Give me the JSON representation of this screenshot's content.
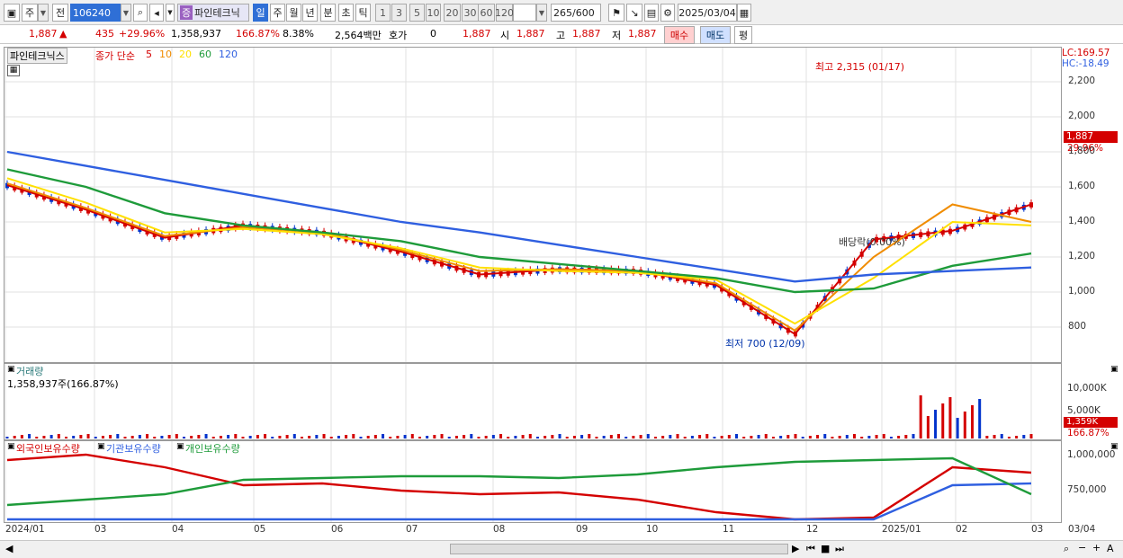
{
  "toolbar": {
    "market": "주",
    "ref": "전",
    "code": "106240",
    "stock_name": "파인테크닉",
    "periods": [
      "일",
      "주",
      "월",
      "년",
      "분",
      "초",
      "틱"
    ],
    "intervals": [
      "1",
      "3",
      "5",
      "10",
      "20",
      "30",
      "60",
      "120"
    ],
    "count": "265",
    "count_max": "/600",
    "date": "2025/03/04"
  },
  "info": {
    "price": "1,887",
    "arrow": "▲",
    "change": "435",
    "change_pct": "+29.96%",
    "volume": "1,358,937",
    "vol_ratio": "166.87%",
    "turnover_pct": "8.38%",
    "amount": "2,564백만",
    "hoga_label": "호가",
    "hoga": "0",
    "hoga_price": "1,887",
    "open_label": "시",
    "open": "1,887",
    "high_label": "고",
    "high": "1,887",
    "low_label": "저",
    "low": "1,887",
    "buy": "매수",
    "sell": "매도",
    "eval": "평"
  },
  "price_pane": {
    "name": "파인테크닉스",
    "ma_label": "종가 단순",
    "ma_periods": [
      "5",
      "10",
      "20",
      "60",
      "120"
    ],
    "ma_colors": [
      "#d40000",
      "#f08c00",
      "#ffe000",
      "#1e9b3a",
      "#2f5fe0"
    ],
    "lc": "LC:169.57",
    "hc": "HC:-18.49",
    "last_price": "1,887",
    "last_pct": "29.96%",
    "ytick": [
      "2,200",
      "2,000",
      "1,800",
      "1,600",
      "1,400",
      "1,200",
      "1,000",
      "800"
    ],
    "annot_high": "최고 2,315 (01/17)",
    "annot_low": "최저 700 (12/09)",
    "annot_div": "배당락(0.00%)"
  },
  "volume_pane": {
    "title": "거래량",
    "value": "1,358,937주(166.87%)",
    "ytick": [
      "10,000K",
      "5,000K"
    ],
    "last": "1,359K",
    "last_pct": "166.87%"
  },
  "holding_pane": {
    "titles": [
      "외국인보유수량",
      "기관보유수량",
      "개인보유수량"
    ],
    "colors": [
      "#d40000",
      "#2f5fe0",
      "#1e9b3a"
    ],
    "ytick": [
      "1,000,000",
      "750,000"
    ]
  },
  "xaxis": [
    "2024/01",
    "03",
    "04",
    "05",
    "06",
    "07",
    "08",
    "09",
    "10",
    "11",
    "12",
    "2025/01",
    "02",
    "03",
    "03/04"
  ],
  "chart_data": {
    "type": "line",
    "x": [
      "2024/01",
      "03",
      "04",
      "05",
      "06",
      "07",
      "08",
      "09",
      "10",
      "11",
      "12",
      "2025/01",
      "02",
      "03"
    ],
    "ylim": [
      700,
      2315
    ],
    "series": [
      {
        "name": "5",
        "values": [
          1610,
          1470,
          1310,
          1380,
          1340,
          1230,
          1100,
          1130,
          1120,
          1040,
          760,
          1300,
          1350,
          1500
        ]
      },
      {
        "name": "10",
        "values": [
          1620,
          1480,
          1320,
          1370,
          1340,
          1240,
          1120,
          1130,
          1120,
          1050,
          780,
          1200,
          1500,
          1400
        ]
      },
      {
        "name": "20",
        "values": [
          1650,
          1510,
          1340,
          1360,
          1330,
          1250,
          1140,
          1120,
          1110,
          1070,
          820,
          1080,
          1400,
          1380
        ]
      },
      {
        "name": "60",
        "values": [
          1700,
          1600,
          1450,
          1380,
          1340,
          1290,
          1200,
          1160,
          1120,
          1080,
          1000,
          1020,
          1150,
          1220
        ]
      },
      {
        "name": "120",
        "values": [
          1800,
          1720,
          1640,
          1560,
          1480,
          1400,
          1340,
          1270,
          1200,
          1130,
          1060,
          1100,
          1120,
          1140
        ]
      }
    ]
  }
}
